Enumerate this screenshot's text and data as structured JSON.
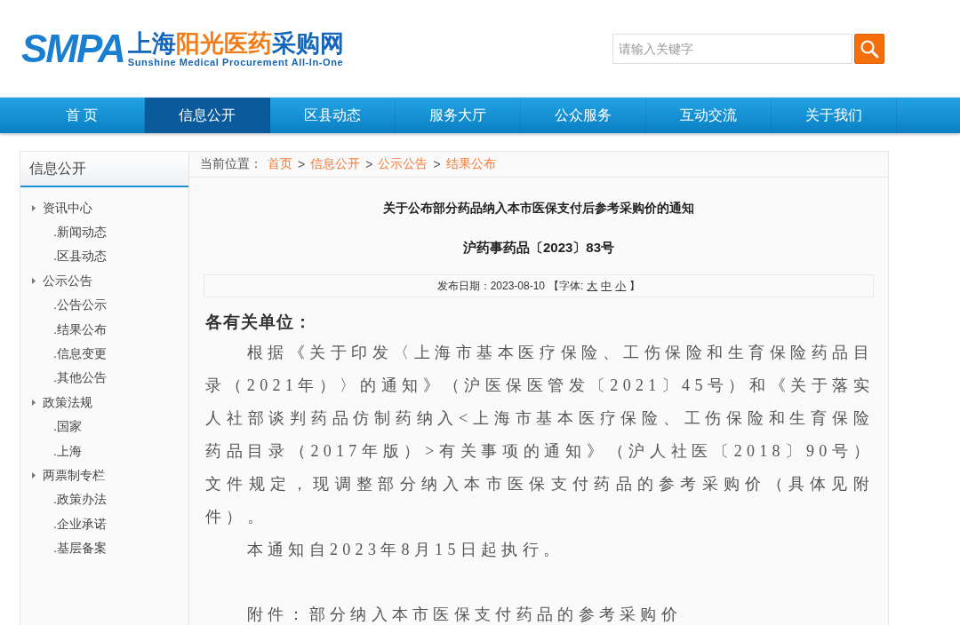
{
  "logo": {
    "mark": "SMPA",
    "title_parts": [
      {
        "text": "上海",
        "color": "#1565b8"
      },
      {
        "text": "阳光医药",
        "color": "#f07d1a"
      },
      {
        "text": "采购网",
        "color": "#1565b8"
      }
    ],
    "subtitle": "Sunshine Medical Procurement All-In-One"
  },
  "search": {
    "placeholder": "请输入关键字"
  },
  "nav": [
    {
      "label": "首 页",
      "selected": false
    },
    {
      "label": "信息公开",
      "selected": true
    },
    {
      "label": "区县动态",
      "selected": false
    },
    {
      "label": "服务大厅",
      "selected": false
    },
    {
      "label": "公众服务",
      "selected": false
    },
    {
      "label": "互动交流",
      "selected": false
    },
    {
      "label": "关于我们",
      "selected": false
    }
  ],
  "sidebar": {
    "title": "信息公开",
    "items": [
      {
        "label": "资讯中心",
        "children": [
          {
            "label": ".新闻动态"
          },
          {
            "label": ".区县动态"
          }
        ]
      },
      {
        "label": "公示公告",
        "children": [
          {
            "label": ".公告公示"
          },
          {
            "label": ".结果公布"
          },
          {
            "label": ".信息变更"
          },
          {
            "label": ".其他公告"
          }
        ]
      },
      {
        "label": "政策法规",
        "children": [
          {
            "label": ".国家"
          },
          {
            "label": ".上海"
          }
        ]
      },
      {
        "label": "两票制专栏",
        "children": [
          {
            "label": ".政策办法"
          },
          {
            "label": ".企业承诺"
          },
          {
            "label": ".基层备案"
          }
        ]
      }
    ]
  },
  "breadcrumb": {
    "label": "当前位置：",
    "items": [
      "首页",
      "信息公开",
      "公示公告",
      "结果公布"
    ],
    "separator": ">"
  },
  "article": {
    "title": "关于公布部分药品纳入本市医保支付后参考采购价的通知",
    "doc_number": "沪药事药品〔2023〕83号",
    "date": "发布日期：2023-08-10",
    "font_label_open": "【字体:",
    "font_sizes": [
      "大",
      "中",
      "小"
    ],
    "font_label_close": "】",
    "salutation": "各有关单位：",
    "paragraphs": [
      {
        "kind": "body",
        "text": "根据《关于印发〈上海市基本医疗保险、工伤保险和生育保险药品目录（2021年）〉的通知》（沪医保医管发〔2021〕45号）和《关于落实人社部谈判药品仿制药纳入<上海市基本医疗保险、工伤保险和生育保险药品目录（2017年版）>有关事项的通知》（沪人社医〔2018〕90号）文件规定，现调整部分纳入本市医保支付药品的参考采购价（具体见附件）。"
      },
      {
        "kind": "body",
        "text": "本通知自2023年8月15日起执行。"
      },
      {
        "kind": "gap"
      },
      {
        "kind": "body",
        "text": "附件：部分纳入本市医保支付药品的参考采购价"
      }
    ]
  }
}
